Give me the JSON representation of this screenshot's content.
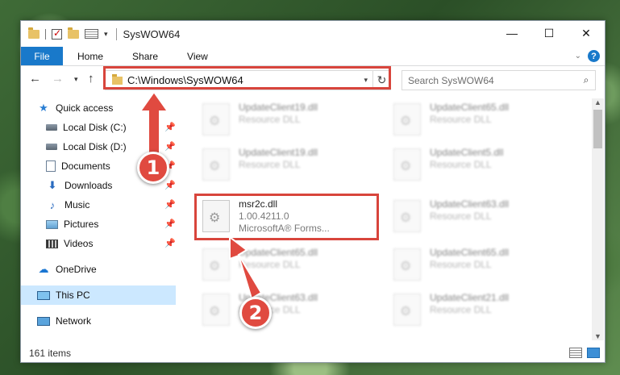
{
  "window": {
    "title": "SysWOW64"
  },
  "ribbon": {
    "tabs": [
      "File",
      "Home",
      "Share",
      "View"
    ]
  },
  "address": {
    "path": "C:\\Windows\\SysWOW64",
    "search_placeholder": "Search SysWOW64"
  },
  "sidebar": {
    "items": [
      {
        "label": "Quick access",
        "icon": "star-icon",
        "pinned": false
      },
      {
        "label": "Local Disk (C:)",
        "icon": "drive-icon",
        "pinned": true
      },
      {
        "label": "Local Disk (D:)",
        "icon": "drive-icon",
        "pinned": true
      },
      {
        "label": "Documents",
        "icon": "documents-icon",
        "pinned": true
      },
      {
        "label": "Downloads",
        "icon": "download-icon",
        "pinned": true
      },
      {
        "label": "Music",
        "icon": "music-icon",
        "pinned": true
      },
      {
        "label": "Pictures",
        "icon": "pictures-icon",
        "pinned": true
      },
      {
        "label": "Videos",
        "icon": "videos-icon",
        "pinned": true
      },
      {
        "label": "OneDrive",
        "icon": "cloud-icon",
        "pinned": false
      },
      {
        "label": "This PC",
        "icon": "computer-icon",
        "pinned": false,
        "selected": true
      },
      {
        "label": "Network",
        "icon": "network-icon",
        "pinned": false
      }
    ]
  },
  "files": {
    "col1": [
      {
        "name": "UpdateClient19.dll",
        "type": "Resource DLL"
      },
      {
        "name": "UpdateClient19.dll",
        "type": "Resource DLL"
      },
      {
        "name": "msr2c.dll",
        "version": "1.00.4211.0",
        "description": "MicrosoftA® Forms..."
      },
      {
        "name": "UpdateClient65.dll",
        "type": "Resource DLL"
      },
      {
        "name": "UpdateClient63.dll",
        "type": "Resource DLL"
      }
    ],
    "col2": [
      {
        "name": "UpdateClient65.dll",
        "type": "Resource DLL"
      },
      {
        "name": "UpdateClient5.dll",
        "type": "Resource DLL"
      },
      {
        "name": "UpdateClient63.dll",
        "type": "Resource DLL"
      },
      {
        "name": "UpdateClient65.dll",
        "type": "Resource DLL"
      },
      {
        "name": "UpdateClient21.dll",
        "type": "Resource DLL"
      }
    ]
  },
  "status": {
    "item_count": "161 items"
  },
  "callouts": [
    "1",
    "2"
  ],
  "colors": {
    "accent": "#1979ca",
    "highlight": "#d8453c",
    "selected": "#cce8ff"
  }
}
